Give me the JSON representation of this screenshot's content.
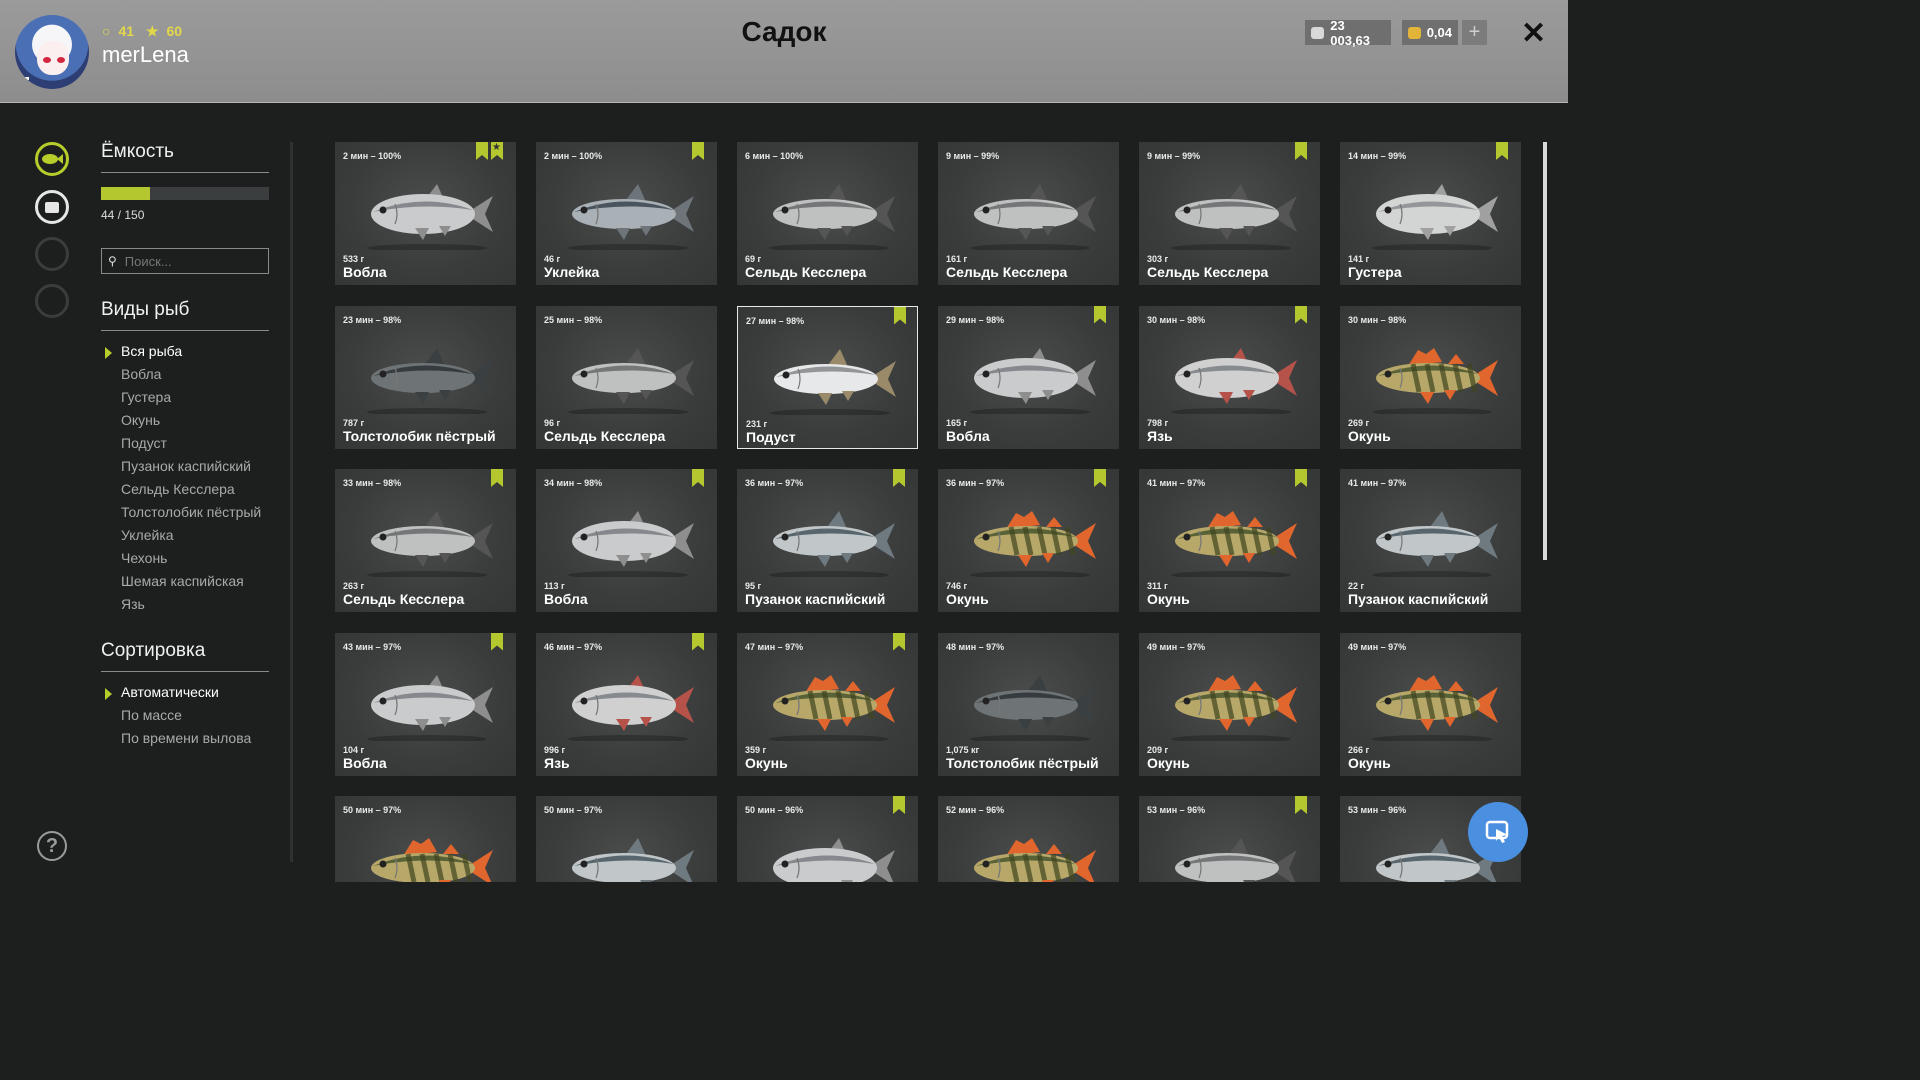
{
  "header": {
    "title": "Садок",
    "username": "merLena",
    "level": "41",
    "stars": "60",
    "silver": "23 003,63",
    "gold": "0,04",
    "plus_label": "+",
    "close_label": "✕"
  },
  "sidebar": {
    "capacity_title": "Ёмкость",
    "capacity_text": "44 / 150",
    "capacity_fraction": 0.293,
    "search_placeholder": "Поиск...",
    "species_title": "Виды рыб",
    "species": [
      "Вся рыба",
      "Вобла",
      "Густера",
      "Окунь",
      "Подуст",
      "Пузанок каспийский",
      "Сельдь Кесслера",
      "Толстолобик пёстрый",
      "Уклейка",
      "Чехонь",
      "Шемая каспийская",
      "Язь"
    ],
    "sort_title": "Сортировка",
    "sort_options": [
      "Автоматически",
      "По массе",
      "По времени вылова"
    ],
    "help_label": "?"
  },
  "colors": {
    "accent": "#b5c72f",
    "fab": "#4a8fe0"
  },
  "cards": [
    {
      "time": "2 мин – 100%",
      "weight": "533 г",
      "name": "Вобла",
      "kind": "roach",
      "bookmark": true,
      "star": true
    },
    {
      "time": "2 мин – 100%",
      "weight": "46 г",
      "name": "Уклейка",
      "kind": "bleak",
      "bookmark": true
    },
    {
      "time": "6 мин – 100%",
      "weight": "69 г",
      "name": "Сельдь Кесслера",
      "kind": "herring"
    },
    {
      "time": "9 мин – 99%",
      "weight": "161 г",
      "name": "Сельдь Кесслера",
      "kind": "herring"
    },
    {
      "time": "9 мин – 99%",
      "weight": "303 г",
      "name": "Сельдь Кесслера",
      "kind": "herring",
      "bookmark": true
    },
    {
      "time": "14 мин – 99%",
      "weight": "141 г",
      "name": "Густера",
      "kind": "bream",
      "bookmark": true
    },
    {
      "time": "23 мин – 98%",
      "weight": "787 г",
      "name": "Толстолобик пёстрый",
      "kind": "carp"
    },
    {
      "time": "25 мин – 98%",
      "weight": "96 г",
      "name": "Сельдь Кесслера",
      "kind": "herring"
    },
    {
      "time": "27 мин – 98%",
      "weight": "231 г",
      "name": "Подуст",
      "kind": "nase",
      "bookmark": true,
      "selected": true
    },
    {
      "time": "29 мин – 98%",
      "weight": "165 г",
      "name": "Вобла",
      "kind": "roach",
      "bookmark": true
    },
    {
      "time": "30 мин – 98%",
      "weight": "798 г",
      "name": "Язь",
      "kind": "ide",
      "bookmark": true
    },
    {
      "time": "30 мин – 98%",
      "weight": "269 г",
      "name": "Окунь",
      "kind": "perch"
    },
    {
      "time": "33 мин – 98%",
      "weight": "263 г",
      "name": "Сельдь Кесслера",
      "kind": "herring",
      "bookmark": true
    },
    {
      "time": "34 мин – 98%",
      "weight": "113 г",
      "name": "Вобла",
      "kind": "roach",
      "bookmark": true
    },
    {
      "time": "36 мин – 97%",
      "weight": "95 г",
      "name": "Пузанок каспийский",
      "kind": "shad",
      "bookmark": true
    },
    {
      "time": "36 мин – 97%",
      "weight": "746 г",
      "name": "Окунь",
      "kind": "perch",
      "bookmark": true
    },
    {
      "time": "41 мин – 97%",
      "weight": "311 г",
      "name": "Окунь",
      "kind": "perch",
      "bookmark": true
    },
    {
      "time": "41 мин – 97%",
      "weight": "22 г",
      "name": "Пузанок каспийский",
      "kind": "shad"
    },
    {
      "time": "43 мин – 97%",
      "weight": "104 г",
      "name": "Вобла",
      "kind": "roach",
      "bookmark": true
    },
    {
      "time": "46 мин – 97%",
      "weight": "996 г",
      "name": "Язь",
      "kind": "ide",
      "bookmark": true
    },
    {
      "time": "47 мин – 97%",
      "weight": "359 г",
      "name": "Окунь",
      "kind": "perch",
      "bookmark": true
    },
    {
      "time": "48 мин – 97%",
      "weight": "1,075 кг",
      "name": "Толстолобик пёстрый",
      "kind": "carp"
    },
    {
      "time": "49 мин – 97%",
      "weight": "209 г",
      "name": "Окунь",
      "kind": "perch"
    },
    {
      "time": "49 мин – 97%",
      "weight": "266 г",
      "name": "Окунь",
      "kind": "perch"
    },
    {
      "time": "50 мин – 97%",
      "weight": "",
      "name": "",
      "kind": "perch"
    },
    {
      "time": "50 мин – 97%",
      "weight": "",
      "name": "",
      "kind": "shad"
    },
    {
      "time": "50 мин – 96%",
      "weight": "",
      "name": "",
      "kind": "roach",
      "bookmark": true
    },
    {
      "time": "52 мин – 96%",
      "weight": "",
      "name": "",
      "kind": "perch"
    },
    {
      "time": "53 мин – 96%",
      "weight": "",
      "name": "",
      "kind": "herring",
      "bookmark": true
    },
    {
      "time": "53 мин – 96%",
      "weight": "",
      "name": "",
      "kind": "shad"
    }
  ]
}
